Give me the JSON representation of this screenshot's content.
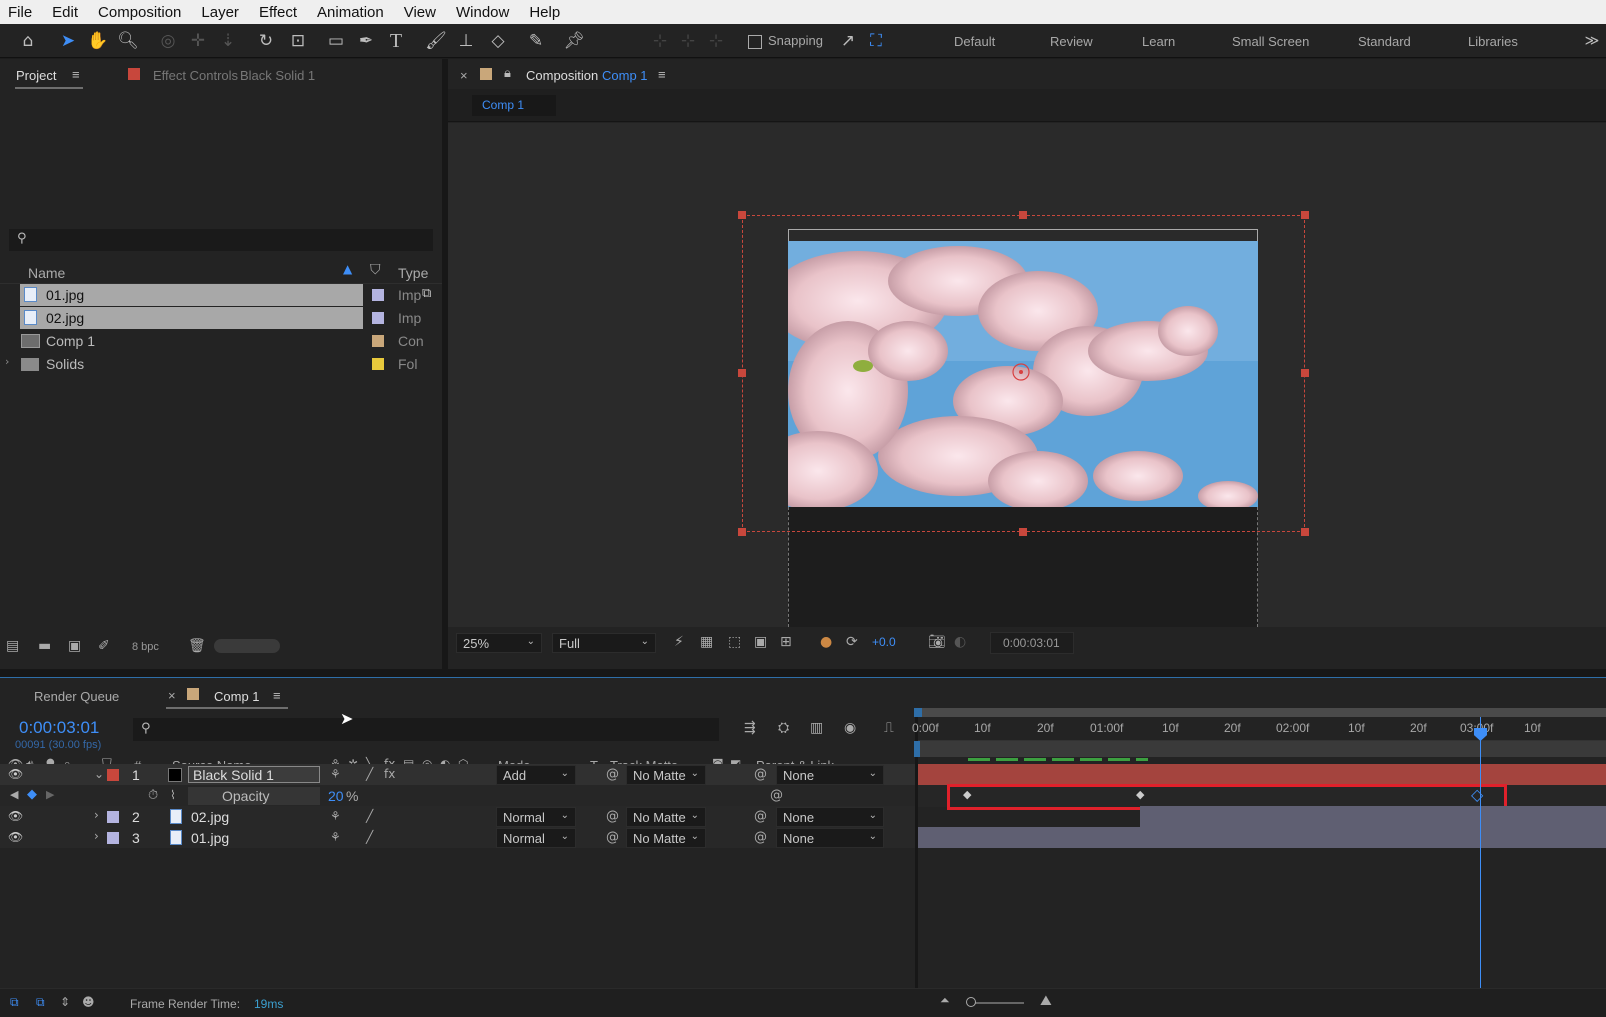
{
  "menu": [
    "File",
    "Edit",
    "Composition",
    "Layer",
    "Effect",
    "Animation",
    "View",
    "Window",
    "Help"
  ],
  "toolbar": {
    "snapping_label": "Snapping",
    "workspaces": [
      "Default",
      "Review",
      "Learn",
      "Small Screen",
      "Standard",
      "Libraries"
    ]
  },
  "project_panel": {
    "tab_project": "Project",
    "tab_effect_controls": "Effect Controls",
    "effect_controls_layer": "Black Solid 1",
    "search_placeholder": "",
    "col_name": "Name",
    "col_type": "Type",
    "items": [
      {
        "name": "01.jpg",
        "type": "Imp",
        "color": "#b4b4e0",
        "selected": true
      },
      {
        "name": "02.jpg",
        "type": "Imp",
        "color": "#b4b4e0",
        "selected": true
      },
      {
        "name": "Comp 1",
        "type": "Con",
        "color": "#c9a77a",
        "selected": false
      },
      {
        "name": "Solids",
        "type": "Fol",
        "color": "#e8c93c",
        "selected": false
      }
    ],
    "bpc": "8 bpc"
  },
  "comp_panel": {
    "tab_prefix": "Composition",
    "tab_comp": "Comp 1",
    "flow_tab": "Comp 1",
    "zoom": "25%",
    "resolution": "Full",
    "exposure": "+0.0",
    "timecode": "0:00:03:01"
  },
  "timeline": {
    "tab_render_queue": "Render Queue",
    "tab_comp": "Comp 1",
    "current_time": "0:00:03:01",
    "frame_info": "00091 (30.00 fps)",
    "headers": {
      "num": "#",
      "source": "Source Name",
      "mode": "Mode",
      "t": "T",
      "track_matte": "Track Matte",
      "parent": "Parent & Link"
    },
    "ruler": [
      "0:00f",
      "10f",
      "20f",
      "01:00f",
      "10f",
      "20f",
      "02:00f",
      "10f",
      "20f",
      "03:00f",
      "10f"
    ],
    "layers": [
      {
        "num": "1",
        "name": "Black Solid 1",
        "mode": "Add",
        "matte": "No Matte",
        "parent": "None",
        "color": "#c8473c"
      },
      {
        "num": "2",
        "name": "02.jpg",
        "mode": "Normal",
        "matte": "No Matte",
        "parent": "None",
        "color": "#b4b4e0"
      },
      {
        "num": "3",
        "name": "01.jpg",
        "mode": "Normal",
        "matte": "No Matte",
        "parent": "None",
        "color": "#b4b4e0"
      }
    ],
    "opacity_label": "Opacity",
    "opacity_value": "20",
    "opacity_unit": "%",
    "status_label": "Frame Render Time:",
    "status_value": "19ms"
  }
}
